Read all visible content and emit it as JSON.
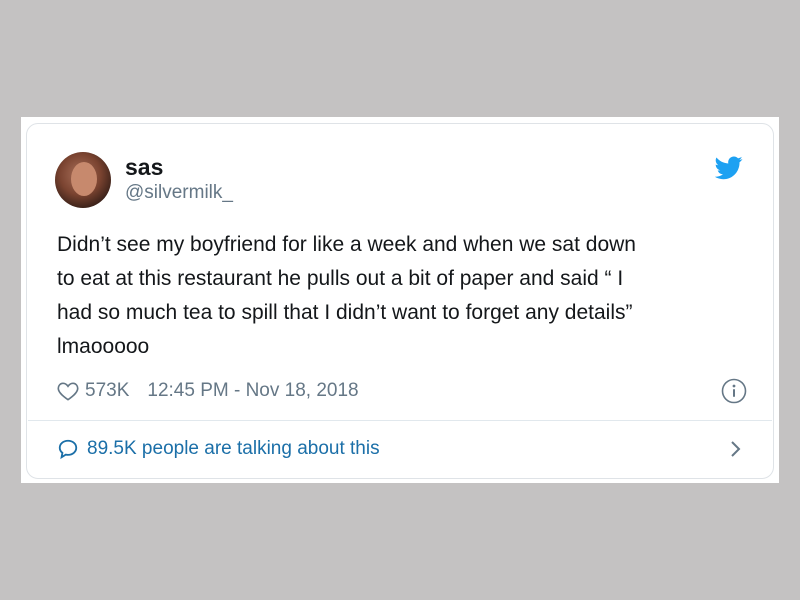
{
  "tweet": {
    "display_name": "sas",
    "handle": "@silvermilk_",
    "text": "Didn’t see my boyfriend for like a week and when we sat down\nto eat at this restaurant he pulls out a bit of paper and said “ I\nhad so much tea to spill that I didn’t want to forget any details”\nlmaooooo",
    "likes": "573K",
    "timestamp": "12:45 PM - Nov 18, 2018",
    "talking": "89.5K people are talking about this"
  },
  "icons": {
    "brand": "twitter-bird-icon",
    "like": "heart-icon",
    "info": "info-icon",
    "replies": "speech-bubble-icon",
    "more": "chevron-right-icon"
  },
  "colors": {
    "background": "#c4c2c2",
    "twitter_blue": "#1da1f2",
    "link_blue": "#1b6fa8",
    "text": "#14171a",
    "muted": "#657786"
  }
}
